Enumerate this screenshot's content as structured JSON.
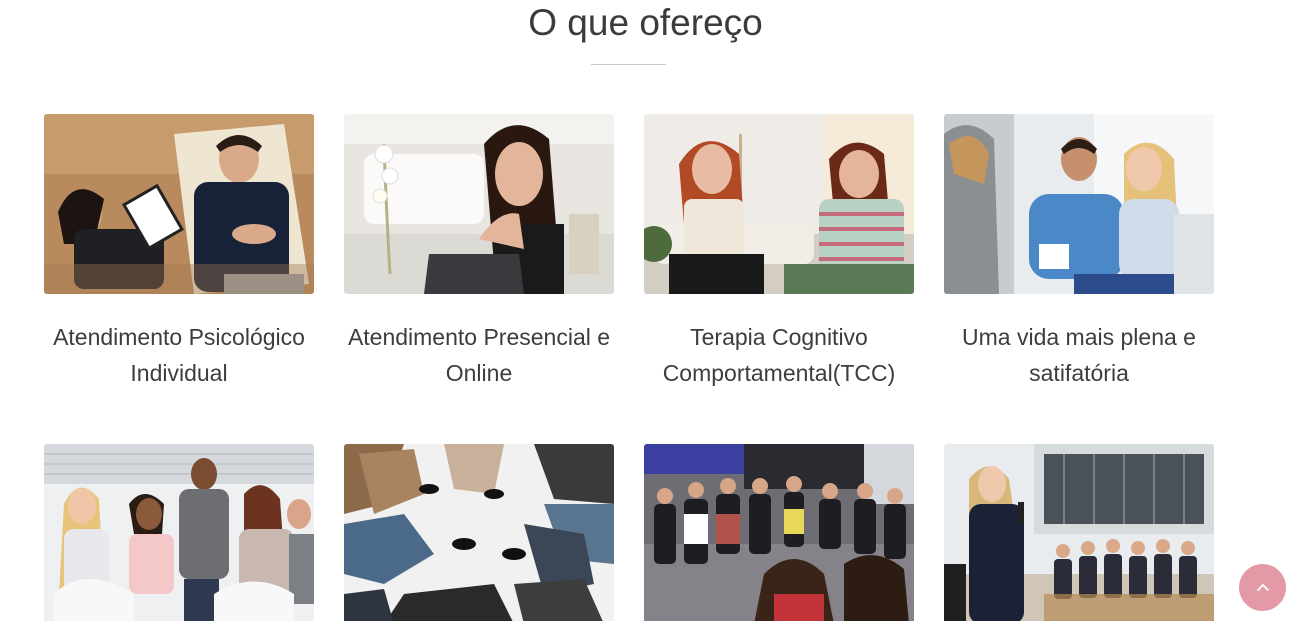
{
  "section": {
    "title": "O que ofereço"
  },
  "services": [
    {
      "title": "Atendimento Psicológico Individual",
      "image_icon": "therapy-couch-photo"
    },
    {
      "title": "Atendimento Presencial e Online",
      "image_icon": "laptop-woman-photo"
    },
    {
      "title": "Terapia Cognitivo Comportamental(TCC)",
      "image_icon": "two-women-talking-photo"
    },
    {
      "title": "Uma vida mais plena e satifatória",
      "image_icon": "happy-couple-photo"
    },
    {
      "title": "",
      "image_icon": "group-therapy-photo"
    },
    {
      "title": "",
      "image_icon": "circle-chairs-photo"
    },
    {
      "title": "",
      "image_icon": "support-group-photo"
    },
    {
      "title": "",
      "image_icon": "speaker-audience-photo"
    }
  ],
  "back_to_top": {
    "icon": "chevron-up-icon",
    "color": "#e39aa6"
  }
}
